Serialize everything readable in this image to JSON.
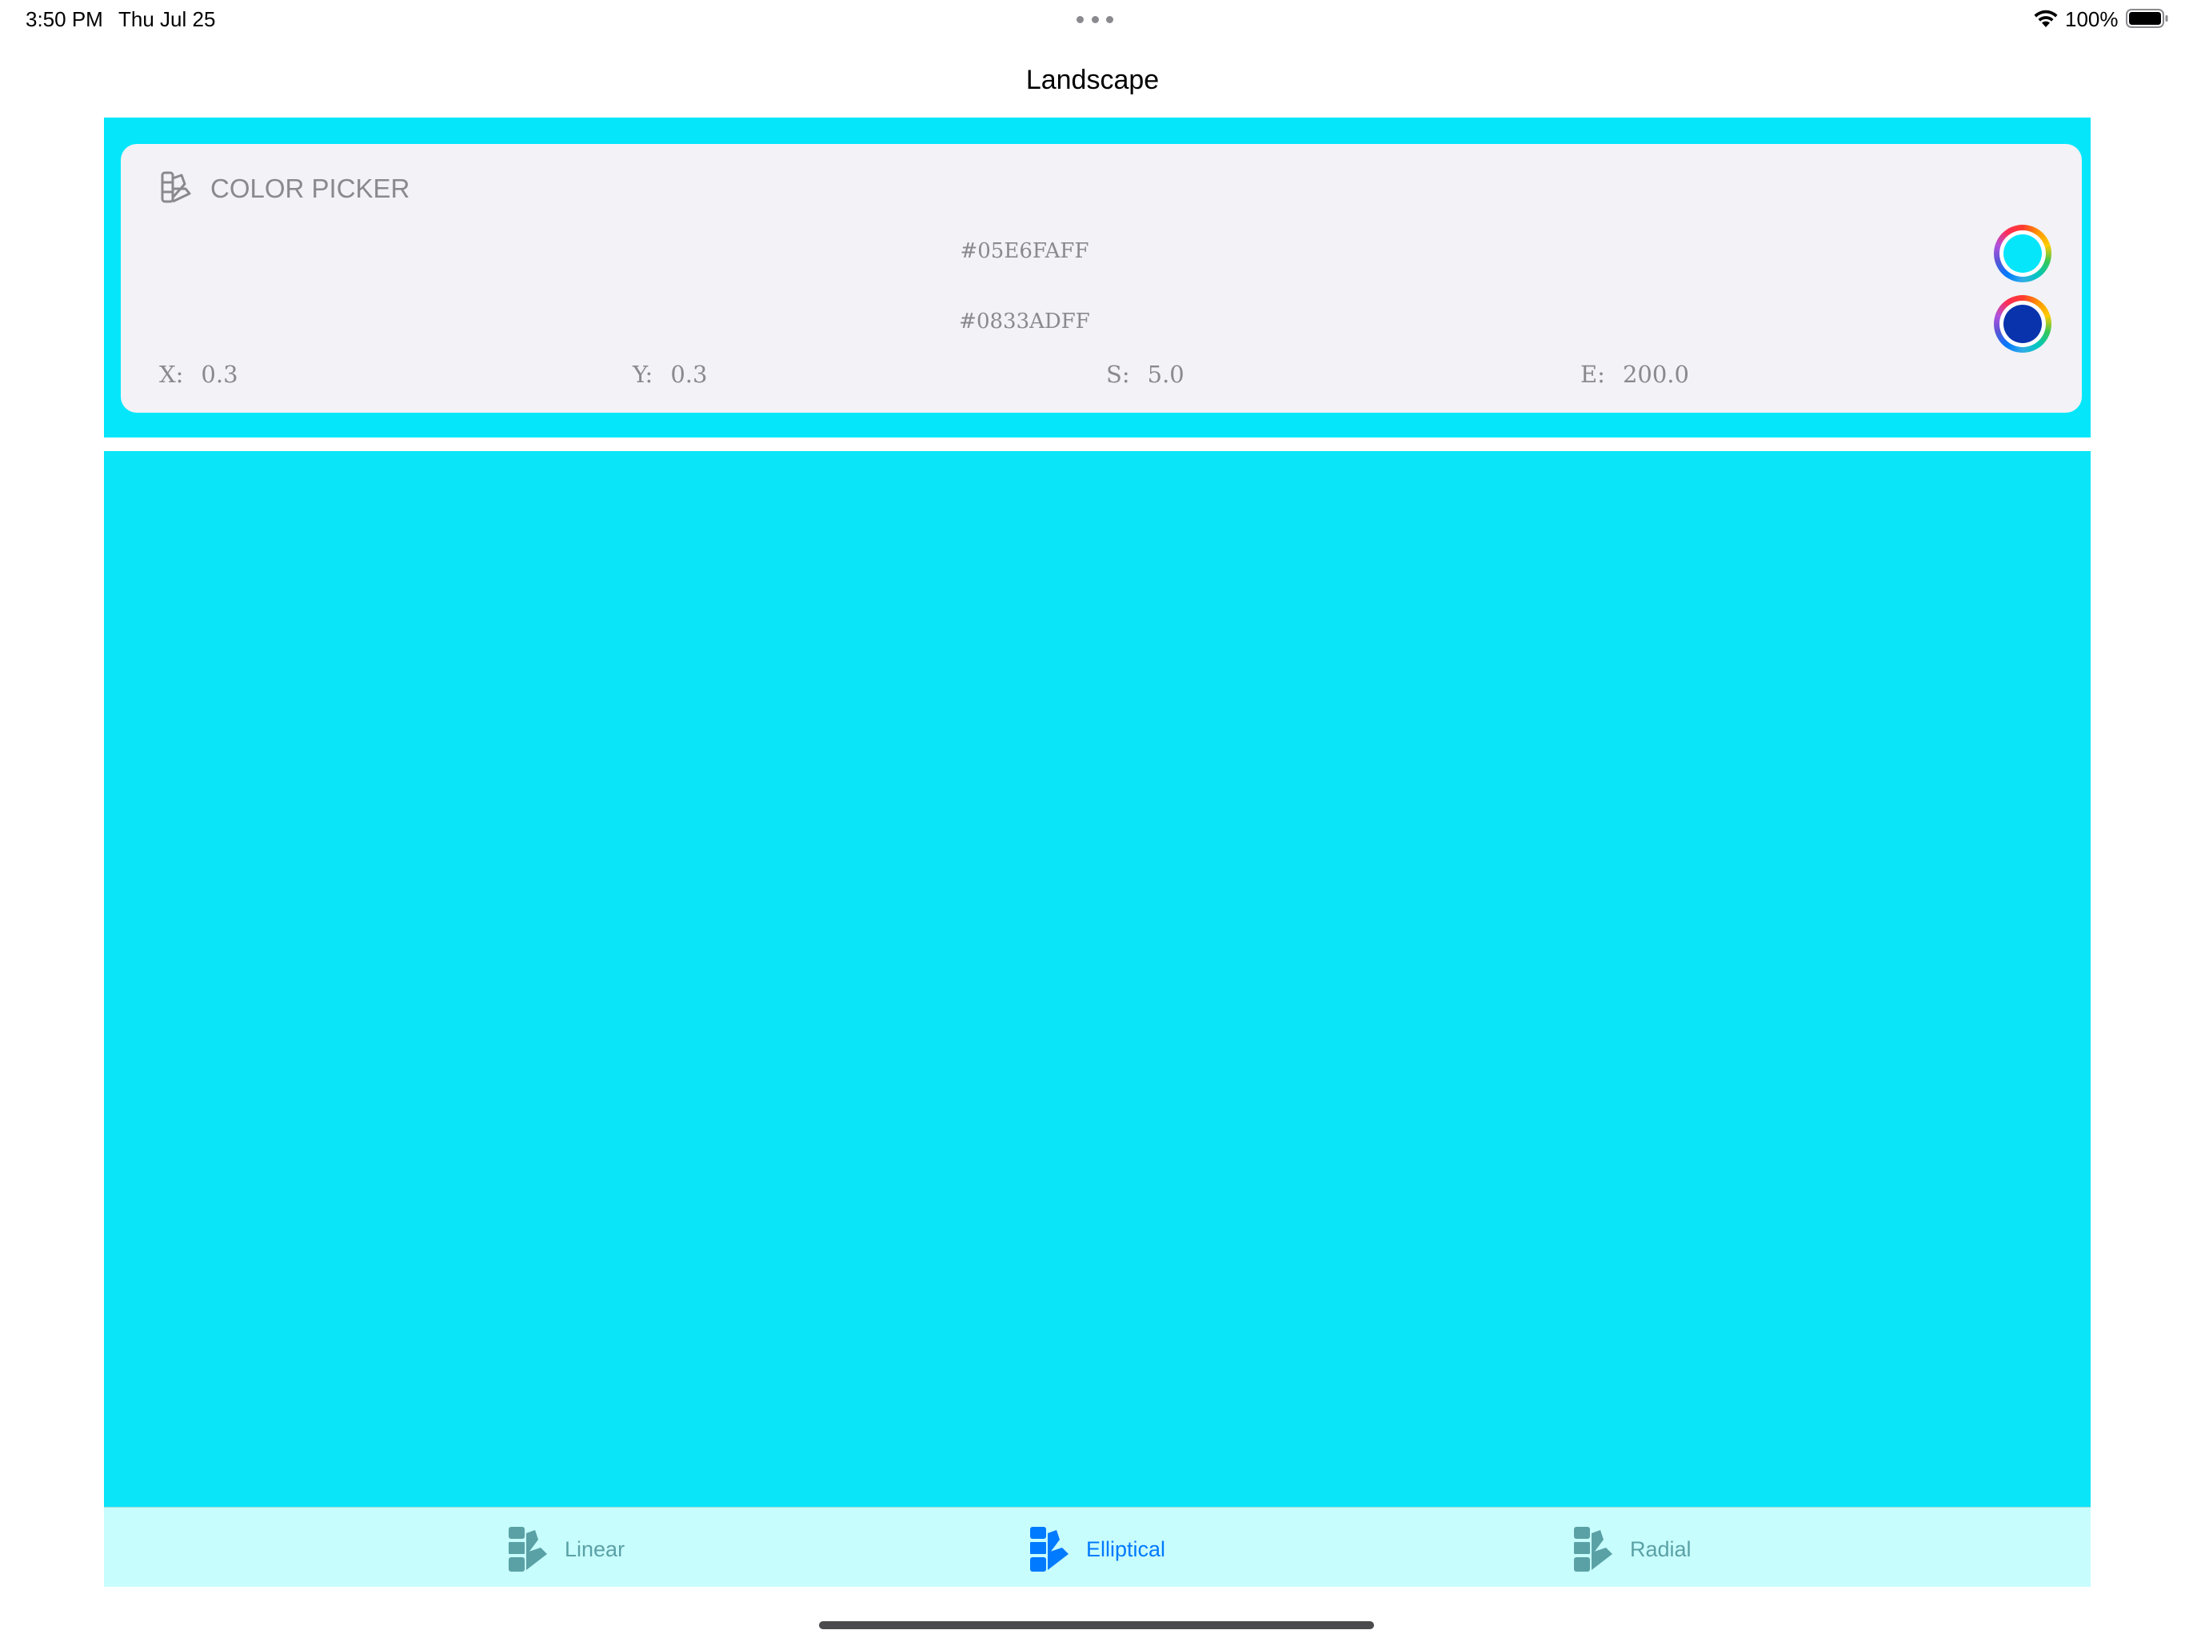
{
  "status_bar": {
    "time": "3:50 PM",
    "date": "Thu Jul 25",
    "battery": "100%"
  },
  "nav": {
    "title": "Landscape"
  },
  "color_picker": {
    "title": "COLOR PICKER",
    "colors": [
      {
        "hex": "#05E6FAFF",
        "swatch": "#05e6fa"
      },
      {
        "hex": "#0833ADFF",
        "swatch": "#0833ad"
      }
    ],
    "params": {
      "x_label": "X:",
      "x_value": "0.3",
      "y_label": "Y:",
      "y_value": "0.3",
      "s_label": "S:",
      "s_value": "5.0",
      "e_label": "E:",
      "e_value": "200.0"
    }
  },
  "colors": {
    "band": "#05e6fa",
    "canvas": "#0ae6f8",
    "tab_bar": "#c8fdfd",
    "tab_active": "#007aff",
    "tab_inactive": "#5aa1a6"
  },
  "tabs": [
    {
      "label": "Linear",
      "icon": "swatchbook-icon",
      "active": false
    },
    {
      "label": "Elliptical",
      "icon": "swatchbook-icon",
      "active": true
    },
    {
      "label": "Radial",
      "icon": "swatchbook-icon",
      "active": false
    }
  ]
}
